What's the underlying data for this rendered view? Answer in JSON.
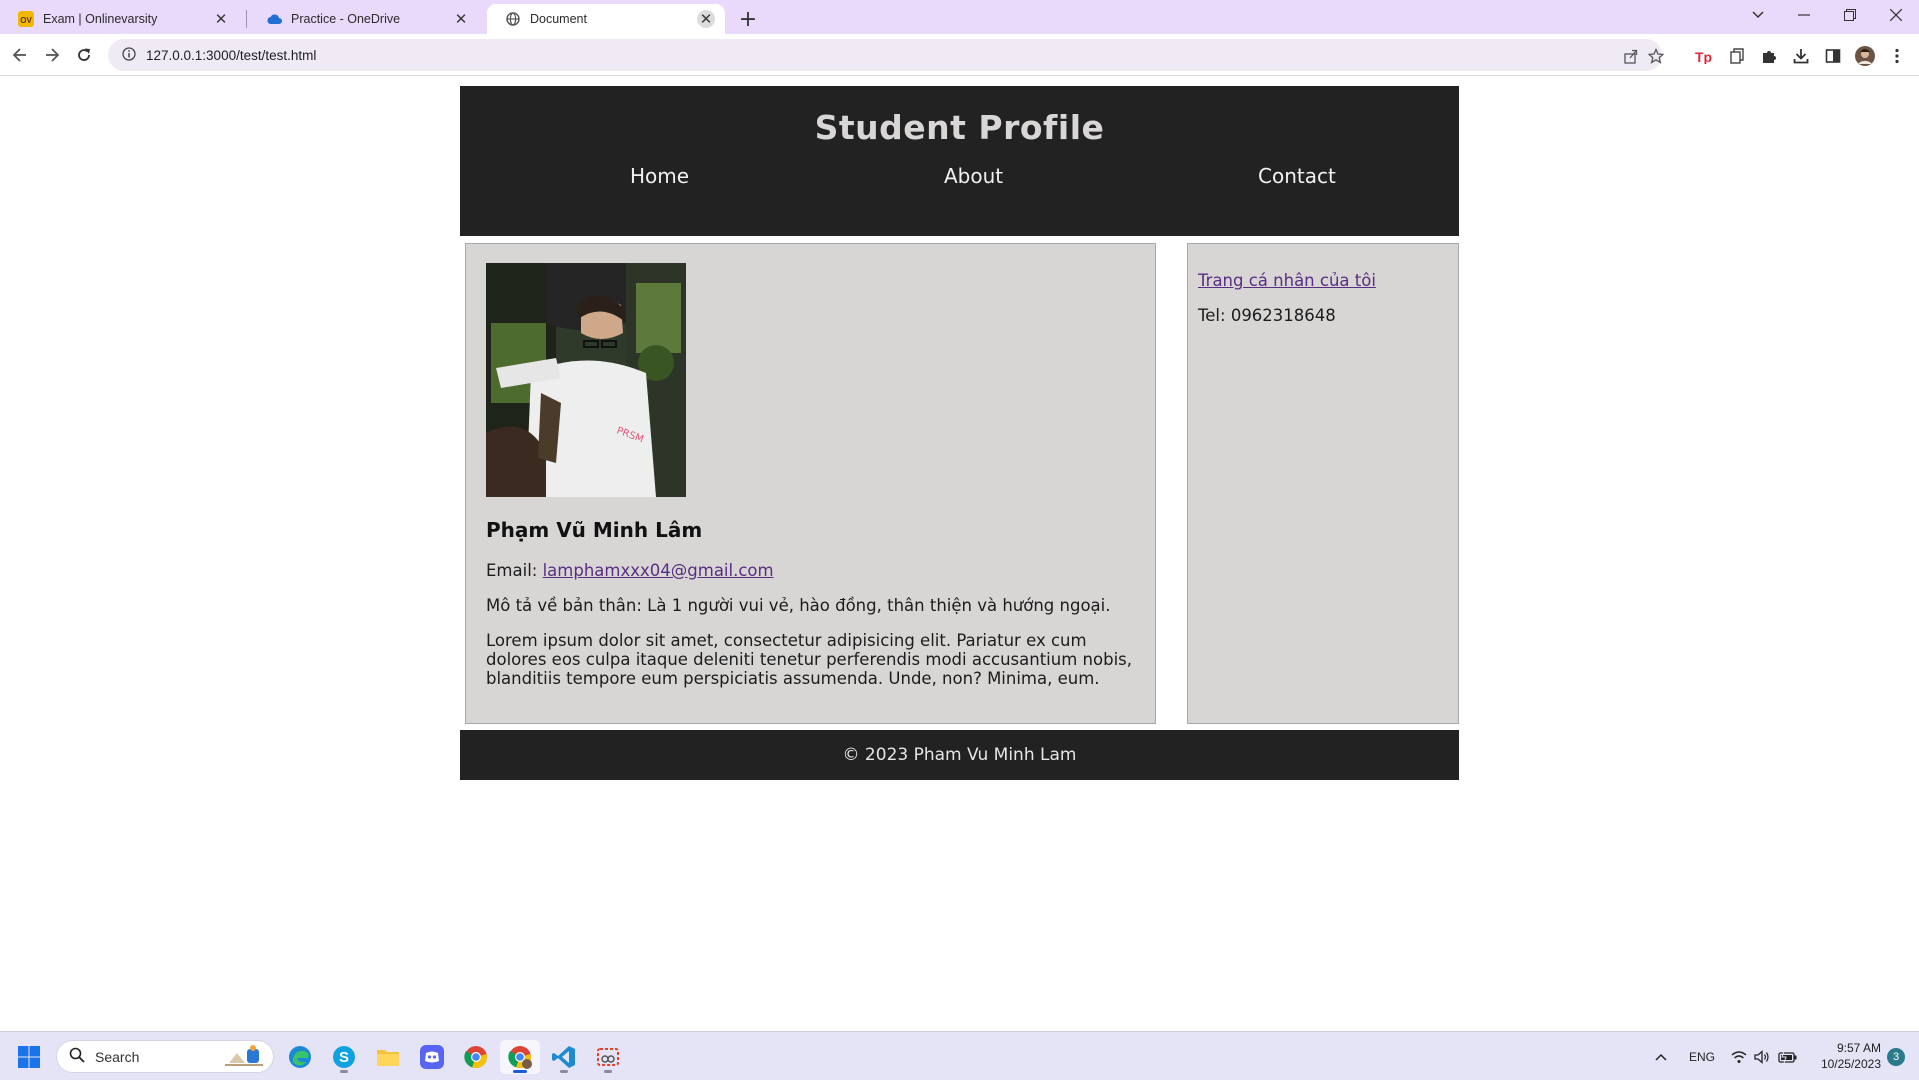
{
  "browser": {
    "tabs": [
      {
        "title": "Exam | Onlinevarsity",
        "favicon": "ov-logo-icon",
        "favicon_text": "OV",
        "active": false
      },
      {
        "title": "Practice - OneDrive",
        "favicon": "onedrive-cloud-icon",
        "active": false
      },
      {
        "title": "Document",
        "favicon": "globe-icon",
        "active": true
      }
    ],
    "address": "127.0.0.1:3000/test/test.html",
    "colors": {
      "tabstrip": "#e9d9fb",
      "omnibox": "#efeaf4"
    }
  },
  "page": {
    "header": {
      "title": "Student Profile",
      "nav": [
        "Home",
        "About",
        "Contact"
      ]
    },
    "profile": {
      "photo_alt": "photo",
      "name": "Phạm Vũ Minh Lâm",
      "email_label": "Email: ",
      "email": "lamphamxxx04@gmail.com",
      "description": "Mô tả về bản thân: Là 1 người vui vẻ, hào đồng, thân thiện và hướng ngoại.",
      "lorem": "Lorem ipsum dolor sit amet, consectetur adipisicing elit. Pariatur ex cum dolores eos culpa itaque deleniti tenetur perferendis modi accusantium nobis, blanditiis tempore eum perspiciatis assumenda. Unde, non? Minima, eum."
    },
    "sidebar": {
      "link": "Trang cá nhân của tôi",
      "tel": "Tel: 0962318648"
    },
    "footer": "© 2023 Pham Vu Minh Lam",
    "colors": {
      "header_bg": "#232222",
      "panel_bg": "#d8d6d5",
      "link": "#5a2d82"
    }
  },
  "taskbar": {
    "search_placeholder": "Search",
    "apps": [
      "edge-icon",
      "skype-icon",
      "file-explorer-icon",
      "discord-icon",
      "chrome-icon",
      "chrome-profile-icon",
      "vscode-icon",
      "snipping-tool-icon"
    ],
    "language": "ENG",
    "time": "9:57 AM",
    "date": "10/25/2023",
    "notifications": "3"
  }
}
